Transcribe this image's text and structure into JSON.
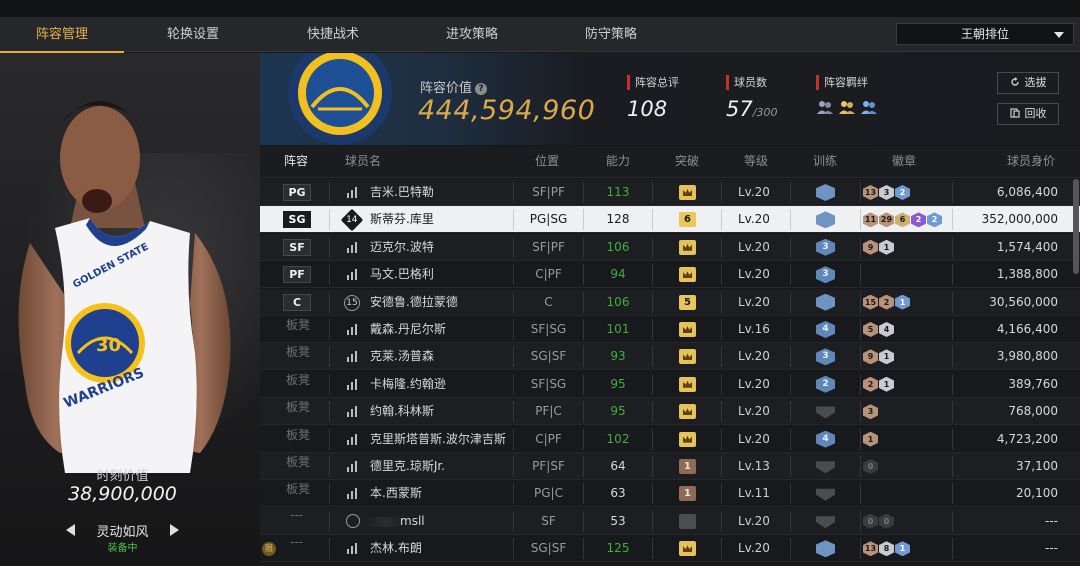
{
  "nav": {
    "tabs": [
      {
        "label": "阵容管理",
        "active": true
      },
      {
        "label": "轮换设置",
        "active": false
      },
      {
        "label": "快捷战术",
        "active": false
      },
      {
        "label": "进攻策略",
        "active": false
      },
      {
        "label": "防守策略",
        "active": false
      }
    ],
    "dropdown": "王朝排位"
  },
  "player_card": {
    "jersey_text": "GOLDEN STATE",
    "jersey_number": "30",
    "jersey_team": "WARRIORS",
    "moment_value_label": "时刻价值",
    "moment_value": "38,900,000",
    "skill_name": "灵动如风",
    "skill_status": "装备中"
  },
  "header": {
    "lineup_value_label": "阵容价值",
    "lineup_value": "444,594,960",
    "rating_label": "阵容总评",
    "rating": "108",
    "player_count_label": "球员数",
    "player_count": "57",
    "player_count_max": "/300",
    "bonds_label": "阵容羁绊",
    "select_button": "选拔",
    "recycle_button": "回收"
  },
  "table": {
    "headers": [
      "阵容",
      "球员名",
      "位置",
      "能力",
      "突破",
      "等级",
      "训练",
      "徽章",
      "球员身价"
    ],
    "rows": [
      {
        "slot": "PG",
        "slot_type": "pos",
        "icon": "stat",
        "name": "吉米.巴特勒",
        "position": "SF|PF",
        "ability": "113",
        "ability_green": true,
        "break_type": "crown",
        "break_val": "",
        "level": "Lv.20",
        "train_type": "crownb",
        "train_val": "",
        "badges": [
          [
            "bronze",
            "13"
          ],
          [
            "silver",
            "3"
          ],
          [
            "blue",
            "2"
          ]
        ],
        "worth": "6,086,400"
      },
      {
        "slot": "SG",
        "slot_type": "pos",
        "icon": "num",
        "num": "14",
        "name": "斯蒂芬.库里",
        "position": "PG|SG",
        "ability": "128",
        "ability_green": false,
        "break_type": "num",
        "break_val": "6",
        "level": "Lv.20",
        "train_type": "crownb",
        "train_val": "",
        "badges": [
          [
            "bronze",
            "11"
          ],
          [
            "bronze",
            "29"
          ],
          [
            "gold",
            "6"
          ],
          [
            "purple",
            "2"
          ],
          [
            "blue",
            "2"
          ]
        ],
        "worth": "352,000,000",
        "active": true
      },
      {
        "slot": "SF",
        "slot_type": "pos",
        "icon": "stat",
        "name": "迈克尔.波特",
        "position": "SF|PF",
        "ability": "106",
        "ability_green": true,
        "break_type": "crown",
        "break_val": "",
        "level": "Lv.20",
        "train_type": "blue",
        "train_val": "3",
        "badges": [
          [
            "bronze",
            "9"
          ],
          [
            "silver",
            "1"
          ]
        ],
        "worth": "1,574,400"
      },
      {
        "slot": "PF",
        "slot_type": "pos",
        "icon": "stat",
        "name": "马文.巴格利",
        "position": "C|PF",
        "ability": "94",
        "ability_green": true,
        "break_type": "crown",
        "break_val": "",
        "level": "Lv.20",
        "train_type": "blue",
        "train_val": "3",
        "badges": [],
        "worth": "1,388,800"
      },
      {
        "slot": "C",
        "slot_type": "pos",
        "icon": "num",
        "num": "15",
        "name": "安德鲁.德拉蒙德",
        "position": "C",
        "ability": "106",
        "ability_green": true,
        "break_type": "num",
        "break_val": "5",
        "level": "Lv.20",
        "train_type": "crownb",
        "train_val": "",
        "badges": [
          [
            "bronze",
            "15"
          ],
          [
            "bronze",
            "2"
          ],
          [
            "blue",
            "1"
          ]
        ],
        "worth": "30,560,000"
      },
      {
        "slot": "板凳",
        "slot_type": "bench",
        "icon": "stat",
        "name": "戴森.丹尼尔斯",
        "position": "SF|SG",
        "ability": "101",
        "ability_green": true,
        "break_type": "crown",
        "break_val": "",
        "level": "Lv.16",
        "train_type": "blue",
        "train_val": "4",
        "badges": [
          [
            "bronze",
            "5"
          ],
          [
            "silver",
            "4"
          ]
        ],
        "worth": "4,166,400"
      },
      {
        "slot": "板凳",
        "slot_type": "bench",
        "icon": "stat",
        "name": "克莱.汤普森",
        "position": "SG|SF",
        "ability": "93",
        "ability_green": true,
        "break_type": "crown",
        "break_val": "",
        "level": "Lv.20",
        "train_type": "blue",
        "train_val": "3",
        "badges": [
          [
            "bronze",
            "9"
          ],
          [
            "silver",
            "1"
          ]
        ],
        "worth": "3,980,800"
      },
      {
        "slot": "板凳",
        "slot_type": "bench",
        "icon": "stat",
        "name": "卡梅隆.约翰逊",
        "position": "SF|SG",
        "ability": "95",
        "ability_green": true,
        "break_type": "crown",
        "break_val": "",
        "level": "Lv.20",
        "train_type": "blue",
        "train_val": "2",
        "badges": [
          [
            "bronze",
            "2"
          ],
          [
            "silver",
            "1"
          ]
        ],
        "worth": "389,760"
      },
      {
        "slot": "板凳",
        "slot_type": "bench",
        "icon": "stat",
        "name": "约翰.科林斯",
        "position": "PF|C",
        "ability": "95",
        "ability_green": true,
        "break_type": "crown",
        "break_val": "",
        "level": "Lv.20",
        "train_type": "gray",
        "train_val": "",
        "badges": [
          [
            "bronze",
            "3"
          ]
        ],
        "worth": "768,000"
      },
      {
        "slot": "板凳",
        "slot_type": "bench",
        "icon": "stat",
        "name": "克里斯塔普斯.波尔津吉斯",
        "position": "C|PF",
        "ability": "102",
        "ability_green": true,
        "break_type": "crown",
        "break_val": "",
        "level": "Lv.20",
        "train_type": "blue",
        "train_val": "4",
        "badges": [
          [
            "bronze",
            "1"
          ]
        ],
        "worth": "4,723,200"
      },
      {
        "slot": "板凳",
        "slot_type": "bench",
        "icon": "stat",
        "name": "德里克.琼斯Jr.",
        "position": "PF|SF",
        "ability": "64",
        "ability_green": false,
        "break_type": "brown",
        "break_val": "1",
        "level": "Lv.13",
        "train_type": "gray",
        "train_val": "",
        "badges": [
          [
            "dark",
            "0"
          ]
        ],
        "worth": "37,100"
      },
      {
        "slot": "板凳",
        "slot_type": "bench",
        "icon": "stat",
        "name": "本.西蒙斯",
        "position": "PG|C",
        "ability": "63",
        "ability_green": false,
        "break_type": "brown",
        "break_val": "1",
        "level": "Lv.11",
        "train_type": "gray",
        "train_val": "",
        "badges": [],
        "worth": "20,100"
      },
      {
        "slot": "---",
        "slot_type": "dash",
        "icon": "avatar",
        "name": "msll",
        "position": "SF",
        "ability": "53",
        "ability_green": false,
        "break_type": "gray",
        "break_val": "",
        "level": "Lv.20",
        "train_type": "gray",
        "train_val": "",
        "badges": [
          [
            "dark",
            "0"
          ],
          [
            "dark",
            "0"
          ]
        ],
        "worth": "---",
        "blurred": true
      },
      {
        "slot": "---",
        "slot_type": "dash",
        "icon": "stat",
        "crown_mini": true,
        "name": "杰林.布朗",
        "position": "SG|SF",
        "ability": "125",
        "ability_green": true,
        "break_type": "crown",
        "break_val": "",
        "level": "Lv.20",
        "train_type": "crownb",
        "train_val": "",
        "badges": [
          [
            "bronze",
            "13"
          ],
          [
            "silver",
            "8"
          ],
          [
            "blue",
            "1"
          ]
        ],
        "worth": "---"
      }
    ]
  },
  "colors": {
    "accent": "#e8a83a",
    "value_gold": "#dba84a",
    "green": "#3fae3f",
    "stat_red": "#c2322d"
  }
}
